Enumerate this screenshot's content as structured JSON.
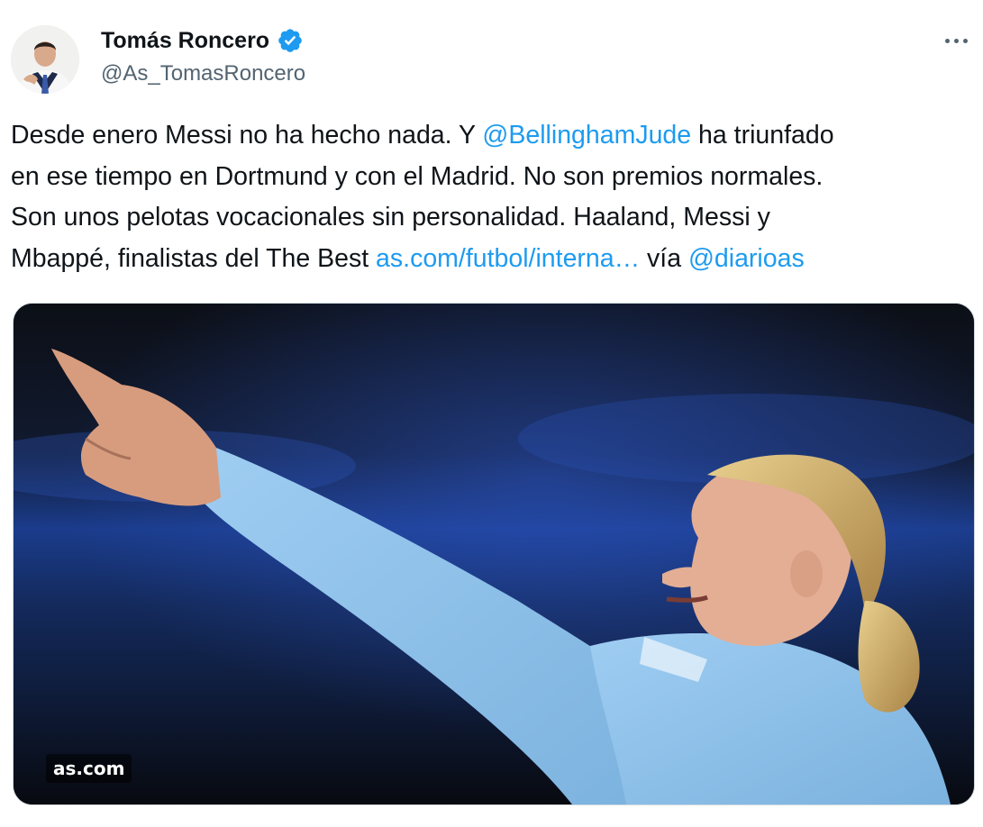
{
  "author": {
    "display_name": "Tomás Roncero",
    "handle": "@As_TomasRoncero",
    "verified": true
  },
  "tweet": {
    "lines": [
      [
        {
          "text": "Desde enero Messi no ha hecho nada. Y ",
          "link": false
        },
        {
          "text": "@BellinghamJude",
          "link": true
        },
        {
          "text": " ha triunfado",
          "link": false
        }
      ],
      [
        {
          "text": "en ese tiempo en Dortmund y con el Madrid. No son premios normales.",
          "link": false
        }
      ],
      [
        {
          "text": "Son unos pelotas vocacionales sin personalidad. Haaland, Messi y",
          "link": false
        }
      ],
      [
        {
          "text": "Mbappé, finalistas del The Best  ",
          "link": false
        },
        {
          "text": "as.com/futbol/interna…",
          "link": true
        },
        {
          "text": " vía ",
          "link": false
        },
        {
          "text": "@diarioas",
          "link": true
        }
      ]
    ]
  },
  "media": {
    "watermark": "as.com"
  },
  "icons": {
    "verified": "verified-badge-icon",
    "more": "more-options-icon"
  },
  "colors": {
    "link": "#1d9bf0",
    "text": "#0f1419",
    "secondary": "#536471",
    "shirt": "#8fc3ec"
  }
}
